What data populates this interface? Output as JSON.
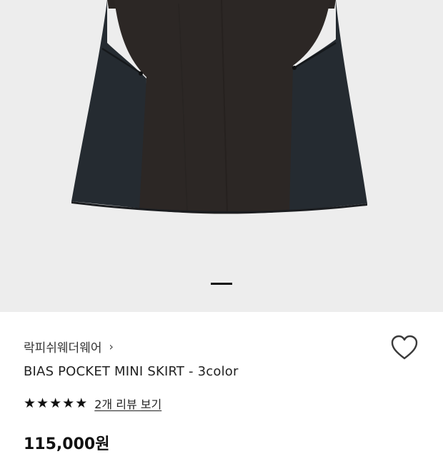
{
  "gallery": {
    "image_description": "skirt",
    "slide_count": 1,
    "active_slide": 1
  },
  "product": {
    "brand": "락피쉬웨더웨어",
    "brand_chevron": "›",
    "title": "BIAS POCKET MINI SKIRT - 3color",
    "rating_stars": 5,
    "review_link": "2개 리뷰 보기",
    "price": "115,000원"
  },
  "icons": {
    "wishlist": "heart-outline-icon",
    "star": "star-icon"
  },
  "colors": {
    "gallery_bg": "#ededed",
    "skirt_center": "#2b2624",
    "skirt_side": "#252b31",
    "accent": "#111111"
  }
}
